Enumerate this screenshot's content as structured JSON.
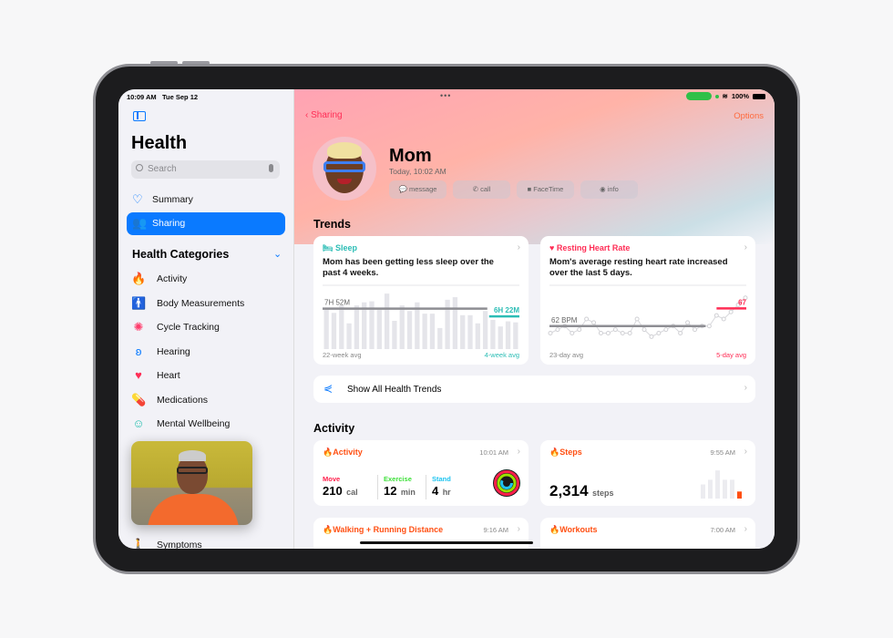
{
  "status_bar": {
    "time": "10:09 AM",
    "date": "Tue Sep 12",
    "battery": "100%"
  },
  "sidebar": {
    "title": "Health",
    "search_placeholder": "Search",
    "nav": [
      {
        "label": "Summary",
        "icon": "heart-outline-icon"
      },
      {
        "label": "Sharing",
        "icon": "people-icon",
        "selected": true
      }
    ],
    "categories_header": "Health Categories",
    "categories": [
      {
        "label": "Activity",
        "icon": "flame-icon",
        "color": "#ff4f12"
      },
      {
        "label": "Body Measurements",
        "icon": "figure-icon",
        "color": "#a050e0"
      },
      {
        "label": "Cycle Tracking",
        "icon": "cycle-icon",
        "color": "#ff3b6b"
      },
      {
        "label": "Hearing",
        "icon": "ear-icon",
        "color": "#0a7aff"
      },
      {
        "label": "Heart",
        "icon": "heart-icon",
        "color": "#ff2d55"
      },
      {
        "label": "Medications",
        "icon": "pills-icon",
        "color": "#3a9ae0"
      },
      {
        "label": "Mental Wellbeing",
        "icon": "head-icon",
        "color": "#2bc0b0"
      }
    ],
    "bottom_item": {
      "label": "Symptoms",
      "icon": "symptoms-icon"
    }
  },
  "header": {
    "back_label": "Sharing",
    "options_label": "Options",
    "name": "Mom",
    "timestamp": "Today, 10:02 AM",
    "actions": [
      {
        "label": "message",
        "icon": "💬"
      },
      {
        "label": "call",
        "icon": "✆"
      },
      {
        "label": "FaceTime",
        "icon": "■"
      },
      {
        "label": "info",
        "icon": "◉"
      }
    ]
  },
  "trends": {
    "title": "Trends",
    "sleep": {
      "title": "Sleep",
      "desc": "Mom has been getting less sleep over the past 4 weeks.",
      "long_avg_label": "7H 52M",
      "short_avg_label": "6H 22M",
      "foot_left": "22-week avg",
      "foot_right": "4-week avg",
      "color": "#2bbdb5"
    },
    "heart": {
      "title": "Resting Heart Rate",
      "desc": "Mom's average resting heart rate increased over the last 5 days.",
      "long_avg_label": "62 BPM",
      "short_avg_label": "67",
      "foot_left": "23-day avg",
      "foot_right": "5-day avg",
      "color": "#ff2d55"
    },
    "show_all": "Show All Health Trends"
  },
  "activity": {
    "title": "Activity",
    "cards": [
      {
        "title": "Activity",
        "time": "10:01 AM",
        "stats": [
          {
            "label": "Move",
            "value": "210",
            "unit": "cal",
            "color": "#ff1f4b"
          },
          {
            "label": "Exercise",
            "value": "12",
            "unit": "min",
            "color": "#3ee03a"
          },
          {
            "label": "Stand",
            "value": "4",
            "unit": "hr",
            "color": "#1ec4f0"
          }
        ]
      },
      {
        "title": "Steps",
        "time": "9:55 AM",
        "value": "2,314",
        "unit": "steps"
      },
      {
        "title": "Walking + Running Distance",
        "time": "9:16 AM"
      },
      {
        "title": "Workouts",
        "time": "7:00 AM"
      }
    ],
    "accent": "#ff4f12"
  },
  "chart_data": [
    {
      "type": "bar",
      "title": "Sleep",
      "ylabel": "hours",
      "values": [
        7.7,
        7.05,
        8.5,
        5.0,
        8.5,
        9.1,
        9.3,
        7.7,
        10.8,
        5.5,
        8.5,
        7.4,
        9.1,
        6.9,
        6.9,
        4.1,
        9.6,
        10.1,
        6.6,
        6.6,
        5.0,
        7.4,
        5.7,
        4.4,
        5.4,
        5.2
      ],
      "ylim": [
        0,
        11
      ],
      "long_avg": 7.87,
      "short_avg": 6.37
    },
    {
      "type": "line",
      "title": "Resting Heart Rate",
      "ylabel": "BPM",
      "values": [
        60,
        61,
        62,
        60,
        61,
        64,
        63,
        60,
        60,
        61,
        60,
        60,
        64,
        61,
        59,
        60,
        61,
        62,
        60,
        63,
        61,
        62,
        62,
        65,
        64,
        66,
        68,
        70
      ],
      "ylim": [
        56,
        72
      ],
      "long_avg": 62,
      "short_avg": 67
    },
    {
      "type": "bar",
      "title": "Steps",
      "values": [
        3,
        4,
        6,
        4,
        4,
        1.5
      ],
      "ylim": [
        0,
        7
      ]
    }
  ]
}
